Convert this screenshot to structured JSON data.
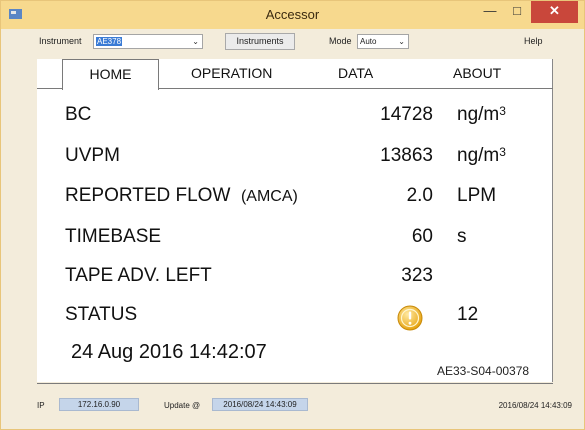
{
  "window": {
    "title": "Accessor",
    "controls": {
      "minimize": "—",
      "maximize": "□",
      "close": "✕"
    }
  },
  "toolbar": {
    "instrument_label": "Instrument",
    "instrument_value": "AE378",
    "instruments_button": "Instruments",
    "mode_label": "Mode",
    "mode_value": "Auto",
    "help_label": "Help",
    "dropdown_chevron": "⌄"
  },
  "tabs": [
    {
      "label": "HOME",
      "active": true
    },
    {
      "label": "OPERATION",
      "active": false
    },
    {
      "label": "DATA",
      "active": false
    },
    {
      "label": "ABOUT",
      "active": false
    }
  ],
  "readings": {
    "bc": {
      "label": "BC",
      "value": "14728",
      "unit": "ng/m",
      "unit_sup": "3"
    },
    "uvpm": {
      "label": "UVPM",
      "value": "13863",
      "unit": "ng/m",
      "unit_sup": "3"
    },
    "flow": {
      "label": "REPORTED FLOW",
      "qualifier": "(AMCA)",
      "value": "2.0",
      "unit": "LPM"
    },
    "timebase": {
      "label": "TIMEBASE",
      "value": "60",
      "unit": "s"
    },
    "tape": {
      "label": "TAPE ADV. LEFT",
      "value": "323"
    },
    "status": {
      "label": "STATUS",
      "icon": "warning-circle-icon",
      "code": "12"
    }
  },
  "timestamp": "24 Aug 2016 14:42:07",
  "serial": "AE33-S04-00378",
  "statusbar": {
    "ip_label": "IP",
    "ip_value": "172.16.0.90",
    "update_label": "Update @",
    "update_value": "2016/08/24 14:43:09",
    "right_timestamp": "2016/08/24 14:43:09"
  },
  "colors": {
    "titlebar": "#f7d98e",
    "window_bg": "#f3ecdb",
    "close_button": "#c9473b",
    "selection": "#3a7bd5",
    "status_icon": "#f0b41c"
  }
}
